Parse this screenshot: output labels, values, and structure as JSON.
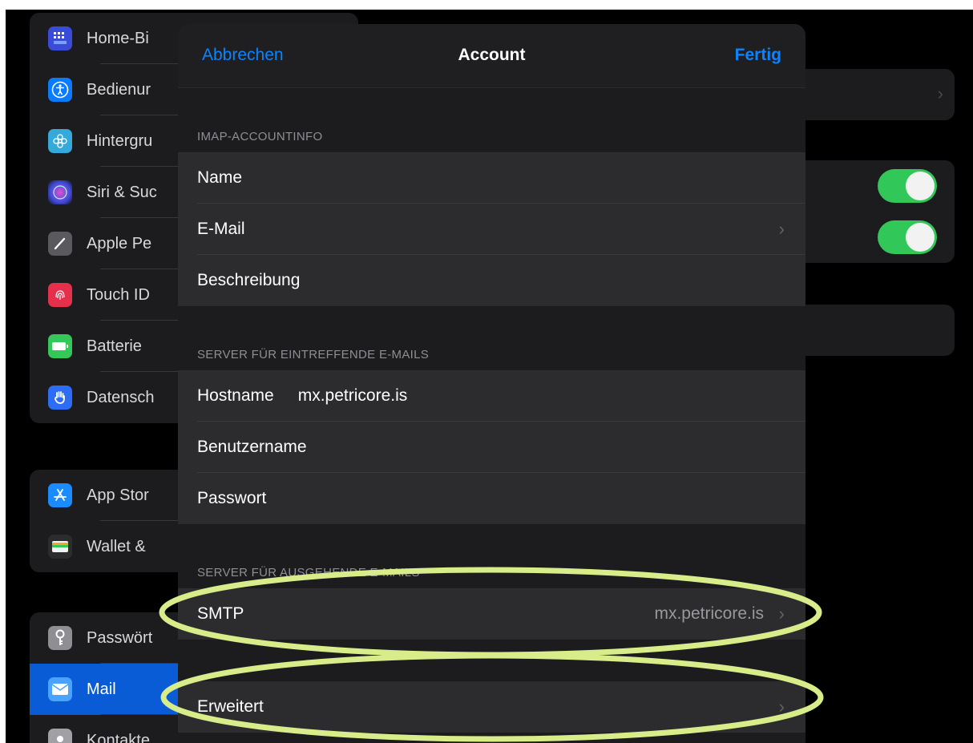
{
  "sidebar": {
    "groups": [
      {
        "items": [
          {
            "label": "Home-Bi",
            "icon": "home-screen-icon",
            "color": "#3a4bd8"
          },
          {
            "label": "Bedienur",
            "icon": "accessibility-icon",
            "color": "#0a7bff"
          },
          {
            "label": "Hintergru",
            "icon": "wallpaper-icon",
            "color": "#35a9d9"
          },
          {
            "label": "Siri & Suc",
            "icon": "siri-icon",
            "color": "#2b2b6e"
          },
          {
            "label": "Apple Pe",
            "icon": "apple-pencil-icon",
            "color": "#5a5a5e"
          },
          {
            "label": "Touch ID",
            "icon": "touch-id-icon",
            "color": "#e5304c"
          },
          {
            "label": "Batterie",
            "icon": "battery-icon",
            "color": "#34c759"
          },
          {
            "label": "Datensch",
            "icon": "privacy-hand-icon",
            "color": "#2d6df6"
          }
        ]
      },
      {
        "items": [
          {
            "label": "App Stor",
            "icon": "app-store-icon",
            "color": "#1a8cff"
          },
          {
            "label": "Wallet &",
            "icon": "wallet-icon",
            "color": "#1c1c1e"
          }
        ]
      },
      {
        "items": [
          {
            "label": "Passwört",
            "icon": "key-icon",
            "color": "#8e8e93"
          },
          {
            "label": "Mail",
            "icon": "mail-icon",
            "color": "#1a8cff",
            "selected": true
          },
          {
            "label": "Kontakte",
            "icon": "contacts-icon",
            "color": "#a0a0a5"
          }
        ]
      }
    ]
  },
  "sheet": {
    "cancel": "Abbrechen",
    "title": "Account",
    "done": "Fertig",
    "sections": [
      {
        "header": "IMAP-ACCOUNTINFO",
        "rows": [
          {
            "label": "Name",
            "value": "",
            "value_right": "",
            "chevron": false
          },
          {
            "label": "E-Mail",
            "value": "",
            "value_right": "",
            "chevron": true
          },
          {
            "label": "Beschreibung",
            "value": "",
            "value_right": "",
            "chevron": false
          }
        ]
      },
      {
        "header": "SERVER FÜR EINTREFFENDE E-MAILS",
        "rows": [
          {
            "label": "Hostname",
            "value": "mx.petricore.is",
            "value_right": "",
            "chevron": false
          },
          {
            "label": "Benutzername",
            "value": "",
            "value_right": "",
            "chevron": false
          },
          {
            "label": "Passwort",
            "value": "",
            "value_right": "",
            "chevron": false
          }
        ]
      },
      {
        "header": "SERVER FÜR AUSGEHENDE E-MAILS",
        "rows": [
          {
            "label": "SMTP",
            "value": "",
            "value_right": "mx.petricore.is",
            "chevron": true
          }
        ]
      },
      {
        "header": "",
        "rows": [
          {
            "label": "Erweitert",
            "value": "",
            "value_right": "",
            "chevron": true
          }
        ]
      }
    ]
  },
  "colors": {
    "accent": "#0a84ff",
    "toggle_on": "#32c759",
    "annotation": "#d9ec8a",
    "selected_row": "#0a5cd6"
  }
}
